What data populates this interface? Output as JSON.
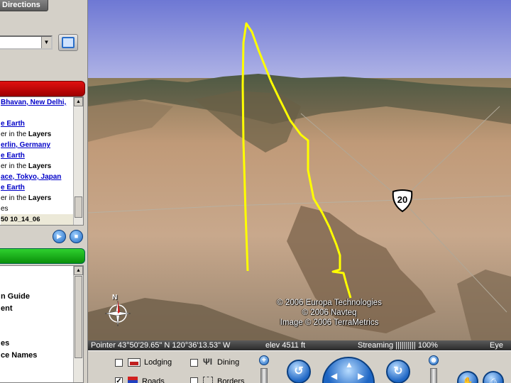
{
  "sidebar": {
    "directions_tab": "Directions",
    "search_combo_value": "",
    "results": [
      {
        "text": "Bhavan, New Delhi,",
        "kind": "link"
      },
      {
        "text": "",
        "kind": "text"
      },
      {
        "text": "e Earth",
        "kind": "link"
      },
      {
        "text": "er in the ",
        "bold": "Layers",
        "kind": "text"
      },
      {
        "text": "erlin, Germany",
        "kind": "link"
      },
      {
        "text": "e Earth",
        "kind": "link"
      },
      {
        "text": "er in the ",
        "bold": "Layers",
        "kind": "text"
      },
      {
        "text": "ace, Tokyo, Japan",
        "kind": "link"
      },
      {
        "text": "e Earth",
        "kind": "link"
      },
      {
        "text": "er in the ",
        "bold": "Layers",
        "kind": "text"
      },
      {
        "text": "es",
        "kind": "text"
      },
      {
        "text": "50 10_14_06",
        "kind": "selected"
      }
    ],
    "layers": [
      "n Guide",
      "ent",
      "",
      "",
      "es",
      "ce Names"
    ]
  },
  "view": {
    "copyright": [
      "© 2006 Europa Technologies",
      "© 2006 Navteq",
      "Image © 2006 TerraMetrics"
    ],
    "route_shield": "20",
    "compass_label": "N",
    "colors": {
      "track": "#ffff00",
      "sky_top": "#7a82d8",
      "sky_bottom": "#b8bce8"
    }
  },
  "status": {
    "pointer": "Pointer  43°50'29.65\" N  120°36'13.53\" W",
    "elev": "elev  4511 ft",
    "streaming": "Streaming |||||||||| 100%",
    "eye": "Eye"
  },
  "controls": {
    "lodging": "Lodging",
    "dining": "Dining",
    "roads": "Roads",
    "borders": "Borders",
    "lodging_checked": false,
    "dining_checked": false,
    "roads_checked": true,
    "borders_checked": false
  }
}
